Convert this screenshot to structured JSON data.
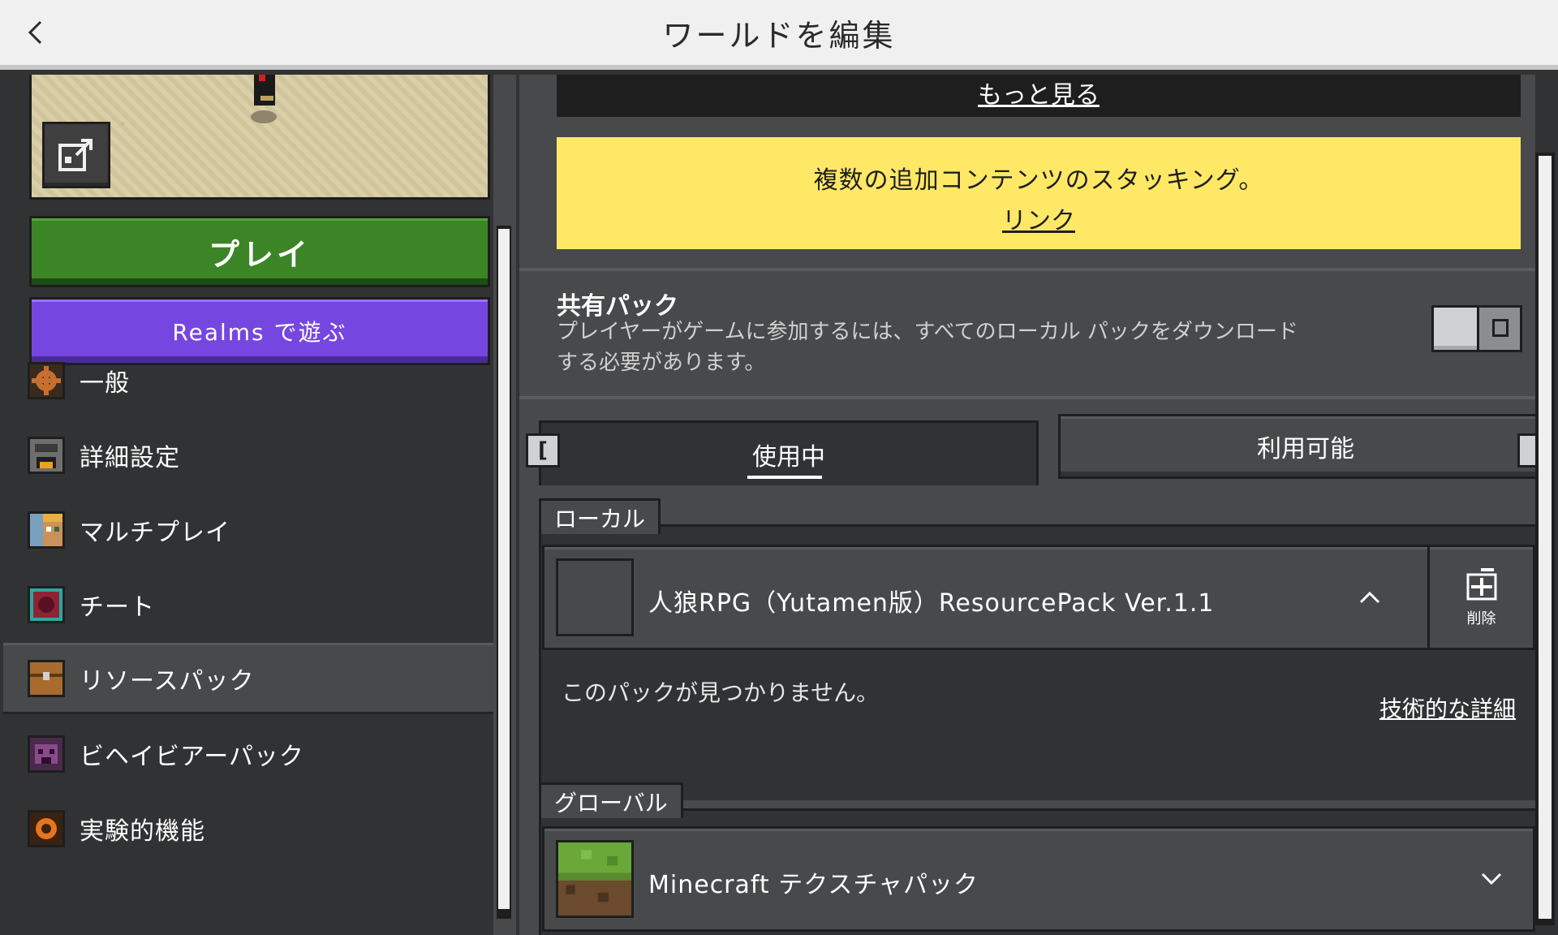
{
  "header": {
    "title": "ワールドを編集",
    "back_icon": "chevron-left-icon"
  },
  "sidebar": {
    "play_label": "プレイ",
    "realms_label": "Realms で遊ぶ",
    "items": [
      {
        "label": "一般",
        "icon": "gear-icon",
        "color": "#c86f30"
      },
      {
        "label": "詳細設定",
        "icon": "furnace-icon",
        "color": "#6e6e6e"
      },
      {
        "label": "マルチプレイ",
        "icon": "player-face-icon",
        "color": "#c9925a"
      },
      {
        "label": "チート",
        "icon": "command-block-icon",
        "color": "#8c2435"
      },
      {
        "label": "リソースパック",
        "icon": "chest-icon",
        "color": "#a86b2d",
        "selected": true
      },
      {
        "label": "ビヘイビアーパック",
        "icon": "creeper-icon",
        "color": "#8a4a8a"
      },
      {
        "label": "実験的機能",
        "icon": "orange-gear-icon",
        "color": "#e8741c"
      }
    ]
  },
  "main": {
    "see_more_link": "もっと見る",
    "notice": {
      "text": "複数の追加コンテンツのスタッキング。",
      "link": "リンク",
      "color": "#ffe866"
    },
    "shared_pack": {
      "title": "共有パック",
      "description": "プレイヤーがゲームに参加するには、すべてのローカル パックをダウンロードする必要があります。",
      "enabled": false
    },
    "tabs": {
      "active": "使用中",
      "inactive": "利用可能",
      "key_hint_left": "["
    },
    "local": {
      "section_label": "ローカル",
      "pack_name": "人狼RPG（Yutamen版）ResourcePack Ver.1.1",
      "delete_label": "削除",
      "missing_message": "このパックが見つかりません。",
      "tech_details_link": "技術的な詳細"
    },
    "global": {
      "section_label": "グローバル",
      "pack_name": "Minecraft テクスチャパック"
    }
  }
}
